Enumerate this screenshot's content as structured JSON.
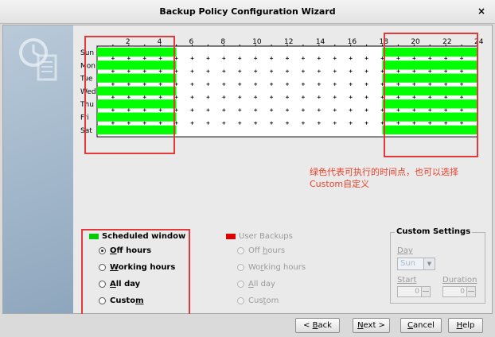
{
  "window": {
    "title": "Backup Policy Configuration Wizard",
    "close_label": "×"
  },
  "annotation": {
    "line1": "绿色代表可执行的时间点，也可以选择",
    "line2": "Custom自定义"
  },
  "schedule_grid": {
    "hour_labels": [
      "2",
      "4",
      "6",
      "8",
      "10",
      "12",
      "14",
      "16",
      "18",
      "20",
      "22",
      "24"
    ],
    "days": [
      "Sun",
      "Mon",
      "Tue",
      "Wed",
      "Thu",
      "Fri",
      "Sat"
    ],
    "scheduled_hours": [
      [
        0,
        5
      ],
      [
        18,
        24
      ]
    ],
    "colors": {
      "scheduled": "#00ff00",
      "border": "#000000"
    }
  },
  "scheduled_window": {
    "title": "Scheduled window",
    "color": "#00cc00",
    "options": [
      "Off hours",
      "Working hours",
      "All day",
      "Custom"
    ],
    "mnemonics": [
      "O",
      "W",
      "A",
      "m"
    ],
    "selected": "Off hours"
  },
  "user_backups": {
    "title": "User Backups",
    "color": "#e00000",
    "options": [
      "Off hours",
      "Working hours",
      "All day",
      "Custom"
    ],
    "mnemonics": [
      "h",
      "r",
      "A",
      "t"
    ]
  },
  "custom_settings": {
    "title": "Custom Settings",
    "day_label": "Day",
    "day_value": "Sun",
    "start_label": "Start",
    "start_value": "0",
    "duration_label": "Duration",
    "duration_value": "0"
  },
  "buttons": {
    "back": "< Back",
    "next": "Next >",
    "cancel": "Cancel",
    "help": "Help"
  },
  "button_mnemonics": {
    "back": "B",
    "next": "N",
    "cancel": "C",
    "help": "H"
  }
}
